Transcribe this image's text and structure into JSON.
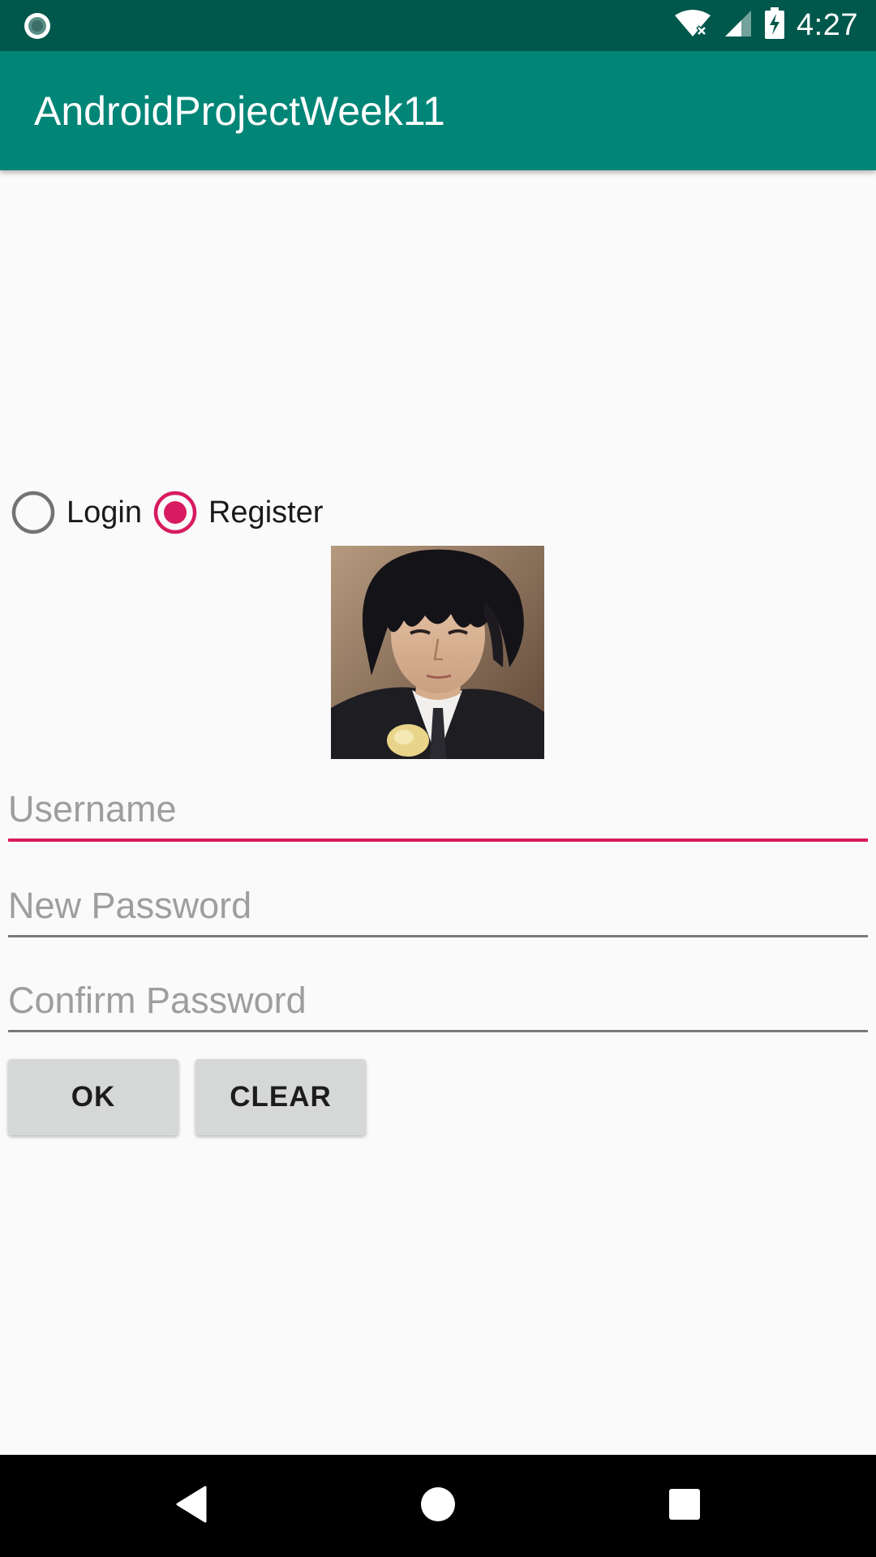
{
  "status_bar": {
    "time": "4:27",
    "icons": [
      "notification-dot-icon",
      "wifi-icon",
      "signal-icon",
      "battery-charging-icon"
    ]
  },
  "app_bar": {
    "title": "AndroidProjectWeek11",
    "color": "#008577"
  },
  "mode_selector": {
    "options": [
      {
        "label": "Login",
        "selected": false
      },
      {
        "label": "Register",
        "selected": true
      }
    ],
    "accent_color": "#d81b60"
  },
  "avatar": {
    "icon": "user-photo"
  },
  "form": {
    "username_placeholder": "Username",
    "new_password_placeholder": "New Password",
    "confirm_password_placeholder": "Confirm Password",
    "focused_field": "username"
  },
  "buttons": {
    "ok_label": "OK",
    "clear_label": "CLEAR"
  },
  "nav_bar": {
    "icons": [
      "back-icon",
      "home-icon",
      "recents-icon"
    ]
  }
}
